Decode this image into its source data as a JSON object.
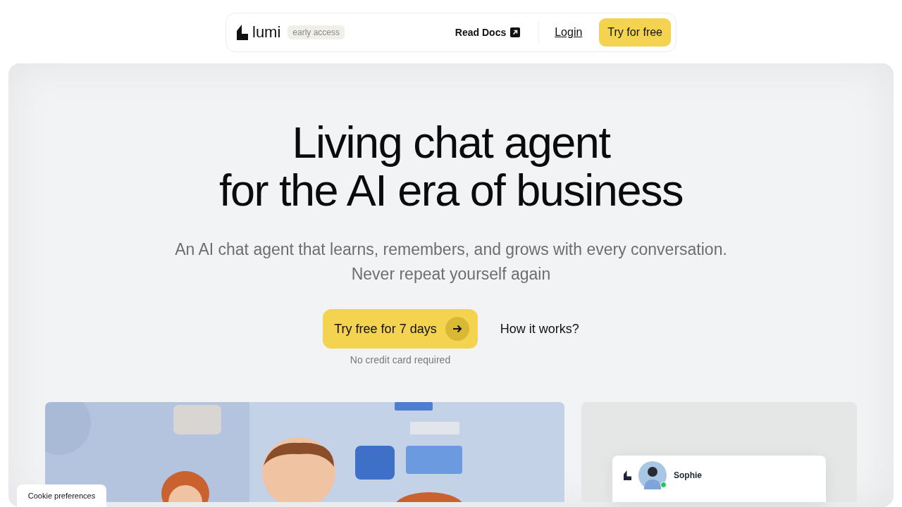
{
  "nav": {
    "logo": "lumi",
    "badge": "early access",
    "links": [
      {
        "label": "Read Docs",
        "kind": "external"
      },
      {
        "label": "Login",
        "kind": "underlined"
      }
    ],
    "cta": "Try for free"
  },
  "hero": {
    "title_lines": [
      "Living chat agent",
      "for the AI era of business"
    ],
    "subtitle_lines": [
      "An AI chat agent that learns, remembers, and grows with every conversation.",
      "Never repeat yourself again"
    ],
    "primary_button": "Try free for 7 days",
    "secondary_button": "How it works?",
    "note": "No credit card required"
  },
  "showcase": {
    "chat": {
      "agent_name": "Sophie",
      "online": true
    }
  },
  "cookie_button": "Cookie preferences"
}
